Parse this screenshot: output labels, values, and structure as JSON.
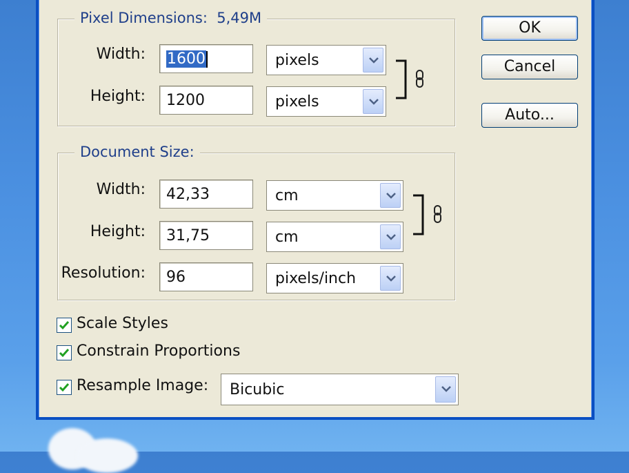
{
  "pixel_dimensions": {
    "legend": "Pixel Dimensions:",
    "size": "5,49M",
    "width": {
      "label": "Width:",
      "value": "1600",
      "unit": "pixels"
    },
    "height": {
      "label": "Height:",
      "value": "1200",
      "unit": "pixels"
    }
  },
  "document_size": {
    "legend": "Document Size:",
    "width": {
      "label": "Width:",
      "value": "42,33",
      "unit": "cm"
    },
    "height": {
      "label": "Height:",
      "value": "31,75",
      "unit": "cm"
    },
    "resolution": {
      "label": "Resolution:",
      "value": "96",
      "unit": "pixels/inch"
    }
  },
  "options": {
    "scale_styles": {
      "label": "Scale Styles",
      "checked": true
    },
    "constrain_proportions": {
      "label": "Constrain Proportions",
      "checked": true
    },
    "resample_image": {
      "label": "Resample Image:",
      "checked": true,
      "method": "Bicubic"
    }
  },
  "buttons": {
    "ok": "OK",
    "cancel": "Cancel",
    "auto": "Auto..."
  },
  "icons": {
    "link": "chain-link-icon",
    "dropdown": "chevron-down-icon",
    "checkbox": "checkmark-icon"
  },
  "colors": {
    "dialog_bg": "#ece9d8",
    "legend_text": "#1f3f8a",
    "frame_blue": "#0a4fc2",
    "selection": "#316ac5"
  }
}
